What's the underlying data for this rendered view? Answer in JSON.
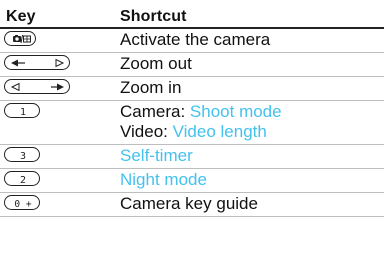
{
  "header": {
    "key": "Key",
    "shortcut": "Shortcut"
  },
  "rows": [
    {
      "key_icon": "camera-album-key-icon",
      "shortcut": "Activate the camera"
    },
    {
      "key_icon": "navigation-left-key-icon",
      "shortcut": "Zoom out"
    },
    {
      "key_icon": "navigation-right-key-icon",
      "shortcut": "Zoom in"
    },
    {
      "key_icon": "number-1-key-icon",
      "key_label": "1",
      "lines": [
        {
          "prefix": "Camera: ",
          "link": "Shoot mode"
        },
        {
          "prefix": "Video: ",
          "link": "Video length"
        }
      ]
    },
    {
      "key_icon": "number-3-key-icon",
      "key_label": "3",
      "link": "Self-timer"
    },
    {
      "key_icon": "number-2-key-icon",
      "key_label": "2",
      "link": "Night mode"
    },
    {
      "key_icon": "number-0-plus-key-icon",
      "key_label": "0 +",
      "shortcut": "Camera key guide"
    }
  ],
  "colors": {
    "link": "#44c1ee",
    "rule": "#222222",
    "row_rule": "#bdbdbd"
  }
}
